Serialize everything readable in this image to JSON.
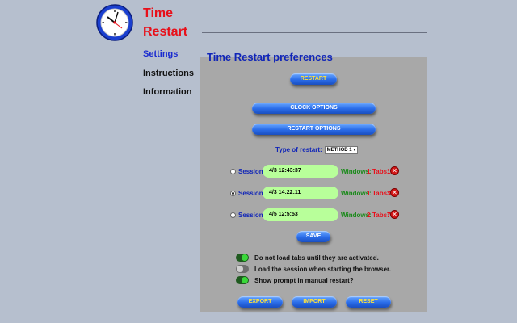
{
  "app": {
    "title_line1": "Time",
    "title_line2": "Restart"
  },
  "nav": [
    {
      "label": "Settings",
      "active": true
    },
    {
      "label": "Instructions",
      "active": false
    },
    {
      "label": "Information",
      "active": false
    }
  ],
  "panel": {
    "title": "Time Restart preferences",
    "restart_label": "RESTART",
    "clock_options_label": "CLOCK OPTIONS",
    "restart_options_label": "RESTART OPTIONS",
    "type_label": "Type of restart:",
    "type_value": "METHOD 1",
    "sessions": [
      {
        "label": "Session:",
        "time": "4/3 12:43:37",
        "windows_label": "Windows:",
        "windows": "1",
        "tabs_label": "Tabs:",
        "tabs": "1",
        "selected": false
      },
      {
        "label": "Session:",
        "time": "4/3 14:22:11",
        "windows_label": "Windows:",
        "windows": "1",
        "tabs_label": "Tabs:",
        "tabs": "3",
        "selected": true
      },
      {
        "label": "Session:",
        "time": "4/5 12:5:53",
        "windows_label": "Windows:",
        "windows": "2",
        "tabs_label": "Tabs:",
        "tabs": "7",
        "selected": false
      }
    ],
    "save_label": "SAVE",
    "options": [
      {
        "label": "Do not load tabs until they are activated.",
        "on": true
      },
      {
        "label": "Load the session when starting the browser.",
        "on": false
      },
      {
        "label": "Show prompt in manual restart?",
        "on": true
      }
    ],
    "export_label": "EXPORT",
    "import_label": "IMPORT",
    "reset_label": "RESET"
  },
  "colors": {
    "background": "#b6bfce",
    "title_red": "#e8101a",
    "accent_blue": "#1025b8",
    "session_green": "#b8ff9a"
  },
  "icons": {
    "logo": "clock-icon",
    "delete": "delete-icon"
  }
}
